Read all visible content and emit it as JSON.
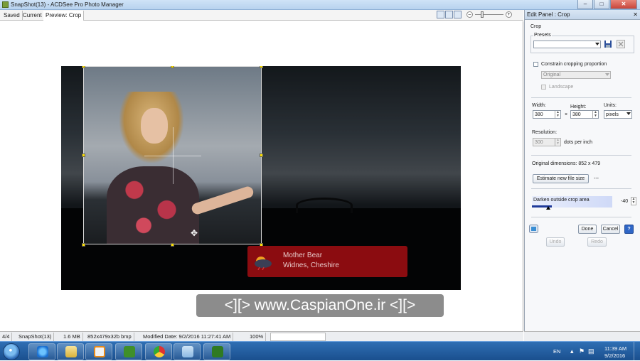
{
  "window": {
    "title": "SnapShot(13) - ACDSee Pro Photo Manager",
    "controls": {
      "minimize": "–",
      "maximize": "□",
      "close": "✕"
    }
  },
  "tabs": [
    {
      "label": "Saved"
    },
    {
      "label": "Current"
    },
    {
      "label": "Preview: Crop"
    }
  ],
  "zoom": {
    "minus": "–",
    "plus": "+"
  },
  "photo": {
    "banner_line1": "Mother Bear",
    "banner_line2": "Widnes, Cheshire"
  },
  "watermark": "<][> www.CaspianOne.ir <][>",
  "panel": {
    "title": "Edit Panel : Crop",
    "close": "✕",
    "section": "Crop",
    "presets_label": "Presets",
    "presets_value": "",
    "constrain_label": "Constrain cropping proportion",
    "constrain_checked": false,
    "ratio_value": "Original",
    "landscape_label": "Landscape",
    "width_label": "Width:",
    "width_value": "380",
    "times": "×",
    "height_label": "Height:",
    "height_value": "380",
    "units_label": "Units:",
    "units_value": "pixels",
    "resolution_label": "Resolution:",
    "resolution_value": "300",
    "resolution_unit": "dots per inch",
    "original_dims": "Original dimensions: 852 x 479",
    "estimate_label": "Estimate new file size",
    "estimate_result": "---",
    "darken_label": "Darken outside crop area",
    "darken_value": "-40",
    "done_label": "Done",
    "cancel_label": "Cancel",
    "help_label": "?",
    "undo_label": "Undo",
    "redo_label": "Redo"
  },
  "statusbar": {
    "index": "4/4",
    "filename": "SnapShot(13)",
    "filesize": "1.6 MB",
    "info": "852x479x32b bmp",
    "modified": "Modified Date: 9/2/2016 11:27:41 AM",
    "zoom": "100%"
  },
  "taskbar": {
    "language": "EN",
    "time": "11:39 AM",
    "date": "9/2/2016",
    "colors": {
      "taskbar": "#1a4f8e",
      "accent": "#2f6fb4"
    }
  }
}
